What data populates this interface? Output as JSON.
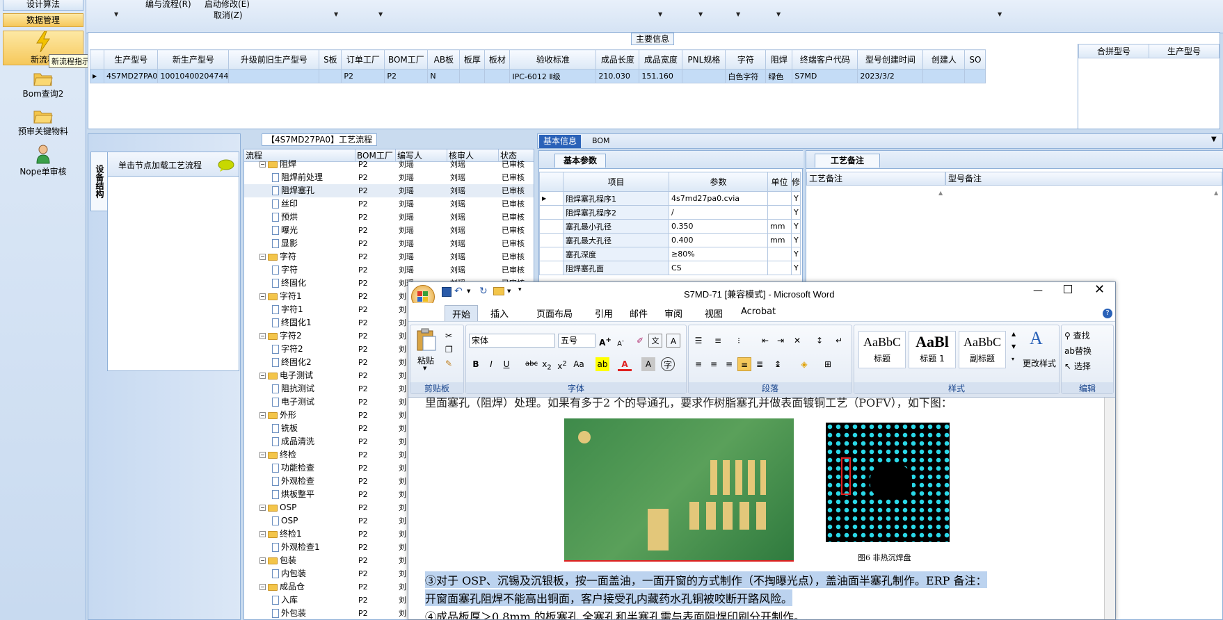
{
  "leftnav": {
    "design_algo": "设计算法",
    "data_mgmt": "数据管理",
    "new_flow": "新流程",
    "bom_query": "Bom查询2",
    "pre_review": "预审关键物料",
    "nope_review": "Nope单审核",
    "tooltip": "新流程指示"
  },
  "toolbar": {
    "edit_flow": "编与流程(R)",
    "start_modify": "启动修改(E)",
    "cancel": "取消(Z)"
  },
  "main_info": {
    "title": "主要信息",
    "columns": [
      "生产型号",
      "新生产型号",
      "升级前旧生产型号",
      "S板",
      "订单工厂",
      "BOM工厂",
      "AB板",
      "板厚",
      "板材",
      "验收标准",
      "成品长度",
      "成品宽度",
      "PNL规格",
      "字符",
      "阻焊",
      "终端客户代码",
      "型号创建时间",
      "创建人",
      "SO"
    ],
    "row": [
      "4S7MD27PA0",
      "10010400204744",
      "",
      "",
      "P2",
      "P2",
      "N",
      "",
      "",
      "IPC-6012 Ⅱ级",
      "210.030",
      "151.160",
      "",
      "白色字符",
      "绿色",
      "S7MD",
      "2023/3/2",
      "",
      ""
    ],
    "side_columns": [
      "合拼型号",
      "生产型号"
    ]
  },
  "process": {
    "vtab": "设备结构",
    "node_hint": "单击节点加载工艺流程",
    "tree_title": "【4S7MD27PA0】工艺流程",
    "columns": [
      "流程",
      "BOM工厂",
      "编写人",
      "核审人",
      "状态"
    ],
    "rows": [
      {
        "name": "阻焊",
        "type": "folder",
        "f": "P2",
        "w": "刘瑶",
        "r": "刘瑶",
        "s": "已审核"
      },
      {
        "name": "阻焊前处理",
        "type": "doc",
        "f": "P2",
        "w": "刘瑶",
        "r": "刘瑶",
        "s": "已审核"
      },
      {
        "name": "阻焊塞孔",
        "type": "doc",
        "f": "P2",
        "w": "刘瑶",
        "r": "刘瑶",
        "s": "已审核"
      },
      {
        "name": "丝印",
        "type": "doc",
        "f": "P2",
        "w": "刘瑶",
        "r": "刘瑶",
        "s": "已审核"
      },
      {
        "name": "预烘",
        "type": "doc",
        "f": "P2",
        "w": "刘瑶",
        "r": "刘瑶",
        "s": "已审核"
      },
      {
        "name": "曝光",
        "type": "doc",
        "f": "P2",
        "w": "刘瑶",
        "r": "刘瑶",
        "s": "已审核"
      },
      {
        "name": "显影",
        "type": "doc",
        "f": "P2",
        "w": "刘瑶",
        "r": "刘瑶",
        "s": "已审核"
      },
      {
        "name": "字符",
        "type": "folder",
        "f": "P2",
        "w": "刘瑶",
        "r": "刘瑶",
        "s": "已审核"
      },
      {
        "name": "字符",
        "type": "doc",
        "f": "P2",
        "w": "刘瑶",
        "r": "刘瑶",
        "s": "已审核"
      },
      {
        "name": "终固化",
        "type": "doc",
        "f": "P2",
        "w": "刘瑶",
        "r": "刘瑶",
        "s": "已审核"
      },
      {
        "name": "字符1",
        "type": "folder",
        "f": "P2",
        "w": "刘",
        "r": "",
        "s": ""
      },
      {
        "name": "字符1",
        "type": "doc",
        "f": "P2",
        "w": "刘",
        "r": "",
        "s": ""
      },
      {
        "name": "终固化1",
        "type": "doc",
        "f": "P2",
        "w": "刘",
        "r": "",
        "s": ""
      },
      {
        "name": "字符2",
        "type": "folder",
        "f": "P2",
        "w": "刘",
        "r": "",
        "s": ""
      },
      {
        "name": "字符2",
        "type": "doc",
        "f": "P2",
        "w": "刘",
        "r": "",
        "s": ""
      },
      {
        "name": "终固化2",
        "type": "doc",
        "f": "P2",
        "w": "刘",
        "r": "",
        "s": ""
      },
      {
        "name": "电子测试",
        "type": "folder",
        "f": "P2",
        "w": "刘",
        "r": "",
        "s": ""
      },
      {
        "name": "阻抗测试",
        "type": "doc",
        "f": "P2",
        "w": "刘",
        "r": "",
        "s": ""
      },
      {
        "name": "电子测试",
        "type": "doc",
        "f": "P2",
        "w": "刘",
        "r": "",
        "s": ""
      },
      {
        "name": "外形",
        "type": "folder",
        "f": "P2",
        "w": "刘",
        "r": "",
        "s": ""
      },
      {
        "name": "铣板",
        "type": "doc",
        "f": "P2",
        "w": "刘",
        "r": "",
        "s": ""
      },
      {
        "name": "成品清洗",
        "type": "doc",
        "f": "P2",
        "w": "刘",
        "r": "",
        "s": ""
      },
      {
        "name": "终检",
        "type": "folder",
        "f": "P2",
        "w": "刘",
        "r": "",
        "s": ""
      },
      {
        "name": "功能检查",
        "type": "doc",
        "f": "P2",
        "w": "刘",
        "r": "",
        "s": ""
      },
      {
        "name": "外观检查",
        "type": "doc",
        "f": "P2",
        "w": "刘",
        "r": "",
        "s": ""
      },
      {
        "name": "烘板整平",
        "type": "doc",
        "f": "P2",
        "w": "刘",
        "r": "",
        "s": ""
      },
      {
        "name": "OSP",
        "type": "folder",
        "f": "P2",
        "w": "刘",
        "r": "",
        "s": ""
      },
      {
        "name": "OSP",
        "type": "doc",
        "f": "P2",
        "w": "刘",
        "r": "",
        "s": ""
      },
      {
        "name": "终检1",
        "type": "folder",
        "f": "P2",
        "w": "刘",
        "r": "",
        "s": ""
      },
      {
        "name": "外观检查1",
        "type": "doc",
        "f": "P2",
        "w": "刘",
        "r": "",
        "s": ""
      },
      {
        "name": "包装",
        "type": "folder",
        "f": "P2",
        "w": "刘",
        "r": "",
        "s": ""
      },
      {
        "name": "内包装",
        "type": "doc",
        "f": "P2",
        "w": "刘",
        "r": "",
        "s": ""
      },
      {
        "name": "成品仓",
        "type": "folder",
        "f": "P2",
        "w": "刘",
        "r": "",
        "s": ""
      },
      {
        "name": "入库",
        "type": "doc",
        "f": "P2",
        "w": "刘",
        "r": "",
        "s": ""
      },
      {
        "name": "外包装",
        "type": "doc",
        "f": "P2",
        "w": "刘",
        "r": "",
        "s": ""
      }
    ]
  },
  "basic": {
    "tab_basic": "基本信息",
    "tab_bom": "BOM",
    "sub_params": "基本参数",
    "sub_notes": "工艺备注",
    "param_cols": [
      "项目",
      "参数",
      "单位",
      "修"
    ],
    "params": [
      {
        "item": "阻焊塞孔程序1",
        "value": "4s7md27pa0.cvia",
        "unit": "",
        "flag": "Y"
      },
      {
        "item": "阻焊塞孔程序2",
        "value": "/",
        "unit": "",
        "flag": "Y"
      },
      {
        "item": "塞孔最小孔径",
        "value": "0.350",
        "unit": "mm",
        "flag": "Y"
      },
      {
        "item": "塞孔最大孔径",
        "value": "0.400",
        "unit": "mm",
        "flag": "Y"
      },
      {
        "item": "塞孔深度",
        "value": "≥80%",
        "unit": "",
        "flag": "Y"
      },
      {
        "item": "阻焊塞孔面",
        "value": "CS",
        "unit": "",
        "flag": "Y"
      }
    ],
    "note_cols": [
      "工艺备注",
      "型号备注"
    ]
  },
  "word": {
    "title": "S7MD-71 [兼容模式] - Microsoft Word",
    "tabs": [
      "开始",
      "插入",
      "页面布局",
      "引用",
      "邮件",
      "审阅",
      "视图",
      "Acrobat"
    ],
    "font_name": "宋体",
    "font_size": "五号",
    "paste": "粘贴",
    "groups": [
      "剪贴板",
      "字体",
      "段落",
      "样式",
      "编辑"
    ],
    "styles": [
      {
        "preview": "AaBbC",
        "name": "标题"
      },
      {
        "preview": "AaBl",
        "name": "标题 1"
      },
      {
        "preview": "AaBbC",
        "name": "副标题"
      }
    ],
    "change_styles": "更改样式",
    "find": "查找",
    "replace": "替换",
    "select": "选择",
    "doc_top_line": "里面塞孔（阻焊）处理。如果有多于2 个的导通孔，要求作树脂塞孔并做表面镀铜工艺（POFV），如下图：",
    "caption": "图6 非热沉焊盘",
    "para3_line1": "③对于 OSP、沉锡及沉银板，按一面盖油，一面开窗的方式制作（不掏曝光点），盖油面半塞孔制作。ERP 备注：",
    "para3_line2": "开窗面塞孔阻焊不能高出铜面，客户接受孔内藏药水孔铜被咬断开路风险。",
    "para4": "④成品板厚＞0.8mm 的板塞孔,全塞孔和半塞孔需与表面阻焊印刷分开制作。."
  }
}
